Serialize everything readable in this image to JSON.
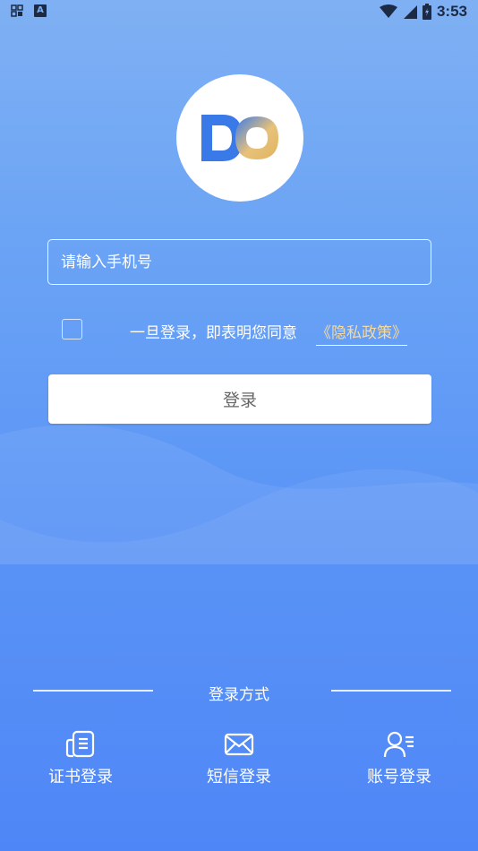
{
  "status_bar": {
    "time": "3:53",
    "icons": [
      "grid-icon",
      "a-badge-icon",
      "wifi-icon",
      "signal-icon",
      "battery-icon"
    ]
  },
  "logo": {
    "alt": "DO"
  },
  "form": {
    "phone_placeholder": "请输入手机号",
    "agree_text": "一旦登录，即表明您同意",
    "privacy_link": "《隐私政策》",
    "login_button": "登录"
  },
  "login_methods": {
    "title": "登录方式",
    "items": [
      {
        "label": "证书登录",
        "icon": "certificate-icon"
      },
      {
        "label": "短信登录",
        "icon": "envelope-icon"
      },
      {
        "label": "账号登录",
        "icon": "user-list-icon"
      }
    ]
  },
  "colors": {
    "background_top": "#7fb0f3",
    "background_bottom": "#4f86f7",
    "link": "#f4d9a0",
    "logo_blue": "#3a7ae8",
    "logo_gold": "#e8c27a"
  }
}
